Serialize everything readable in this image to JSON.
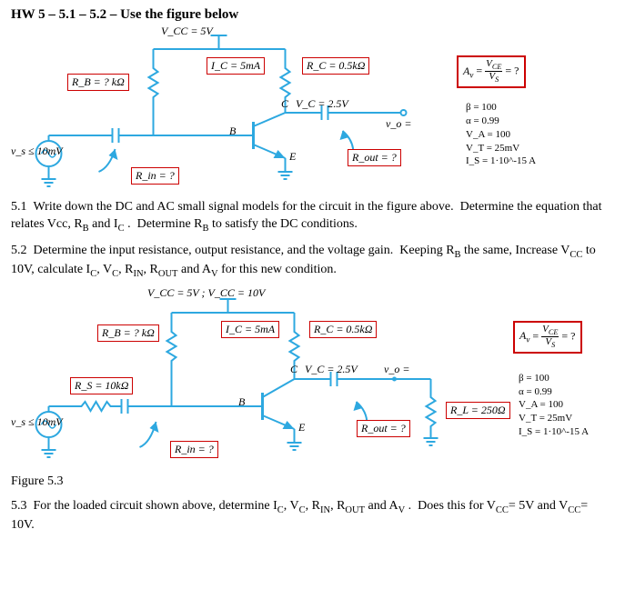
{
  "header": {
    "title": "HW 5 – 5.1 – 5.2 – Use the figure below"
  },
  "fig1": {
    "vcc": "V_CC = 5V",
    "rb": "R_B = ? kΩ",
    "ic": "I_C = 5mA",
    "rc": "R_C = 0.5kΩ",
    "vc": "V_C = 2.5V",
    "vo": "v_o =",
    "rout": "R_out = ?",
    "rin": "R_in = ?",
    "vs": "v_s ≤ 10mV",
    "nodeB": "B",
    "nodeC": "C",
    "nodeE": "E",
    "av_box": "A_v = V_CE / V_S = ?",
    "params": {
      "beta": "β = 100",
      "alpha": "α = 0.99",
      "va": "V_A = 100",
      "vt": "V_T = 25mV",
      "is": "I_S = 1·10^-15 A"
    }
  },
  "q51": "5.1  Write down the DC and AC small signal models for the circuit in the figure above.  Determine the equation that relates Vcc, R_B and I_C .  Determine R_B to satisfy the DC conditions.",
  "q52": "5.2  Determine the input resistance, output resistance, and the voltage gain.  Keeping R_B the same, Increase V_CC to 10V, calculate I_C, V_C, R_IN, R_OUT and A_V for this new condition.",
  "fig2": {
    "vcc": "V_CC = 5V ; V_CC = 10V",
    "rb": "R_B = ? kΩ",
    "rs": "R_S = 10kΩ",
    "ic": "I_C = 5mA",
    "rc": "R_C = 0.5kΩ",
    "vc": "V_C = 2.5V",
    "vo": "v_o =",
    "rout": "R_out = ?",
    "rin": "R_in = ?",
    "rl": "R_L = 250Ω",
    "vs": "v_s ≤ 10mV",
    "nodeB": "B",
    "nodeC": "C",
    "nodeE": "E",
    "av_box": "A_v = V_CE / V_S = ?",
    "params": {
      "beta": "β = 100",
      "alpha": "α = 0.99",
      "va": "V_A = 100",
      "vt": "V_T = 25mV",
      "is": "I_S = 1·10^-15 A"
    }
  },
  "figcap": "Figure 5.3",
  "q53": "5.3  For the loaded circuit shown above, determine I_C, V_C, R_IN, R_OUT and A_V .  Does this for V_CC= 5V and V_CC= 10V."
}
